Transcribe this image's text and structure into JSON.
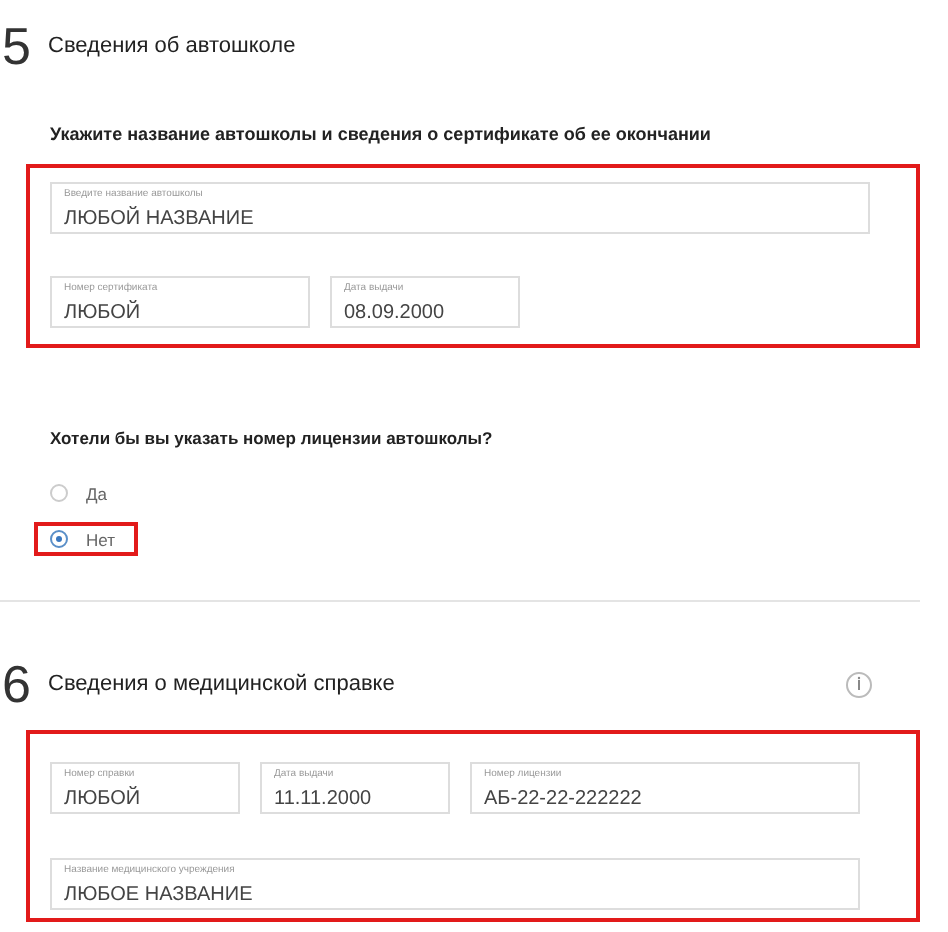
{
  "sections": [
    {
      "number": "5",
      "title": "Сведения об автошколе",
      "subtitle": "Укажите название автошколы и сведения о сертификате об ее окончании",
      "highlighted": true,
      "field_rows": [
        [
          {
            "label": "Введите название автошколы",
            "value": "ЛЮБОЙ НАЗВАНИЕ"
          }
        ],
        [
          {
            "label": "Номер сертификата",
            "value": "ЛЮБОЙ"
          },
          {
            "label": "Дата выдачи",
            "value": "08.09.2000"
          }
        ]
      ],
      "question": "Хотели бы вы указать номер лицензии автошколы?",
      "options": [
        {
          "label": "Да",
          "selected": false,
          "highlighted": false
        },
        {
          "label": "Нет",
          "selected": true,
          "highlighted": true
        }
      ]
    },
    {
      "number": "6",
      "title": "Сведения о медицинской справке",
      "has_info_icon": true,
      "highlighted": true,
      "field_rows": [
        [
          {
            "label": "Номер справки",
            "value": "ЛЮБОЙ"
          },
          {
            "label": "Дата выдачи",
            "value": "11.11.2000"
          },
          {
            "label": "Номер лицензии",
            "value": "АБ-22-22-222222"
          }
        ],
        [
          {
            "label": "Название медицинского учреждения",
            "value": "ЛЮБОЕ НАЗВАНИЕ"
          }
        ]
      ]
    }
  ]
}
